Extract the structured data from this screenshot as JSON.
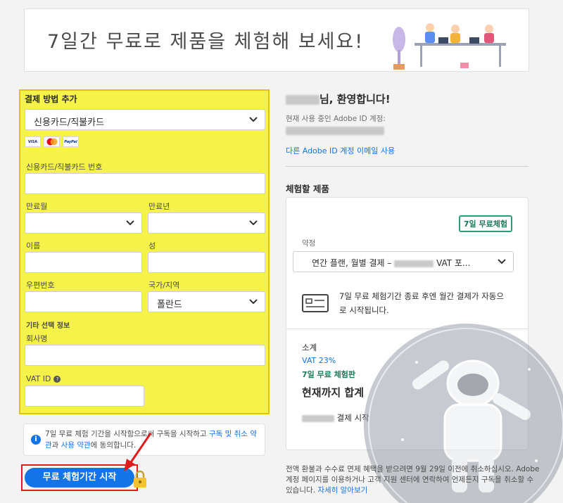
{
  "banner": {
    "title": "7일간 무료로 제품을 체험해 보세요!"
  },
  "payment": {
    "title": "결제 방법 추가",
    "method": "신용카드/직불카드",
    "card_logos": [
      "VISA",
      "Mastercard",
      "PayPal"
    ],
    "card_number_label": "신용카드/직불카드 번호",
    "exp_month_label": "만료월",
    "exp_year_label": "만료년",
    "first_name_label": "이름",
    "last_name_label": "성",
    "postal_label": "우편번호",
    "country_label": "국가/지역",
    "country_value": "폴란드",
    "optional_label": "기타 선택 정보",
    "company_label": "회사명",
    "vat_label": "VAT ID"
  },
  "terms": {
    "text_before": "7일 무료 체험 기간을 시작함으로써 구독을 시작하고 ",
    "link1": "구독 및 취소 약관",
    "text_mid": "과 ",
    "link2": "사용 약관",
    "text_after": "에 동의합니다."
  },
  "start_button": "무료 체험기간 시작",
  "account": {
    "welcome_suffix": "님, 환영합니다!",
    "current_label": "현재 사용 중인 Adobe ID 계정:",
    "other_link": "다른 Adobe ID 계정 이메일 사용"
  },
  "product": {
    "section_title": "체험할 제품",
    "badge": "7일 무료체험",
    "plan_label": "약정",
    "plan_value_left": "연간 플랜, 월별 결제 –",
    "plan_value_right": "VAT 포...",
    "auto_text": "7일 무료 체험기간 종료 후엔 월간 결제가 자동으로 시작됩니다.",
    "subtotal": "소계",
    "vat": "VAT 23%",
    "trial": "7일 무료 체험판",
    "total": "현재까지 합계",
    "pay_start": "결제 시작"
  },
  "refund": {
    "text": "전액 환불과 수수료 면제 혜택을 받으려면 9월 29일 이전에 취소하십시오. Adobe 계정 페이지를 이용하거나 고객 지원 센터에 연락하여 언제든지 구독을 취소할 수 있습니다. ",
    "link": "자세히 알아보기"
  },
  "colors": {
    "accent": "#1473e6",
    "highlight": "#f5f24a",
    "green": "#2d9d78",
    "alert": "#e01b1b"
  }
}
